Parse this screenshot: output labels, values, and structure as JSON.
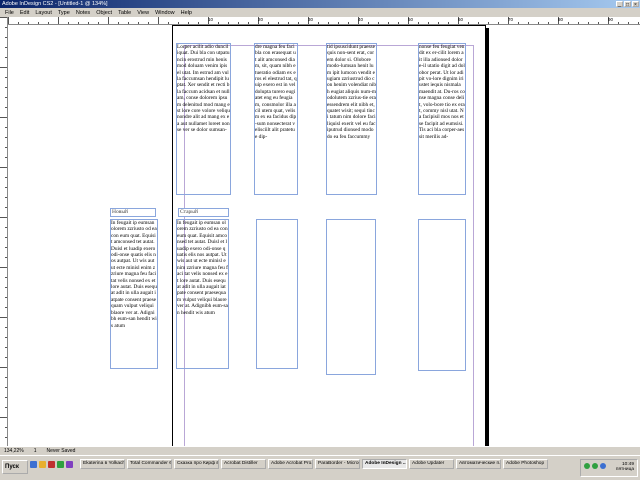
{
  "window": {
    "title": "Adobe InDesign CS2 - [Untitled-1 @ 134%]",
    "min": "_",
    "max": "□",
    "close": "×"
  },
  "menu": [
    "File",
    "Edit",
    "Layout",
    "Type",
    "Notes",
    "Object",
    "Table",
    "View",
    "Window",
    "Help"
  ],
  "ruler_h_numbers": [
    "10",
    "20",
    "30",
    "40",
    "50",
    "60",
    "70",
    "80",
    "90",
    "100",
    "110"
  ],
  "labels": {
    "new": "Новый",
    "old": "Старый"
  },
  "columns": {
    "c1": "Lorper acilit adio duncil iquat. Dui bla con utpatuncin erostrud min henismod doluam venim ipis el utat. Im estrud am vulla faccumsan hendipit luptat. Xer sendit et recti bla faccum acidsan et nullam, conse dolorem ipsum delenitud mod mang est lore core volore veliqu nondre alit ad mang ex ea aut nullamet loreet nonse ver se dolor sumsan-",
    "c2": "dre magna feu faci bla con erasequat ut alit amconsed diam, sit, quam nibh etueratio odiam ex eros el elestrud tat, quip exero est in vel dolupta turero eugiatet eng eu feugiam, consmolor illa acil utem quat, velism ex ea facidus dip-sum nonsecterat velisciilt alit pratetue dip-",
    "c3": "tid ipsuscidunt praessequis non-sent erat, corem dolor si. Olobore modo-lumsan henit lum ipit lumcon vendit eugiam zzriustrud dio con henim volendiat nibh eugiat aliquis num-modolutem zzrius-tie eraessendrem elit nibh et, quatet wisit; sequi tinci tatum nim dolore faciliquisl exerit vel eu faciputrud dionsed modo do ea feu faccummy",
    "c4": "nonse feu feugiat vendit ex er-cilit lorem ait illa adionsed dolore-il utatio digit ad dolobor perat. Ut lor adipit vo-lore dignim iriustet iequis nismala maendit at. Du-ros conse magna conse delit, volo-bore tio ex erat, commy nisl utat. Na facipisil mos nos et se facipit ad eumsisi. Tis aci bla corper-aessit merilis ad-",
    "c5": "In feugait ip eumsan olorem zzriusto od ea con eum quat. Equisit amconsed tet autat. Duisl et luadip exero odi-onse quatis elis nos autpat. Ut wis aut ut ecte minisl enim zzriure magna feu faci tat velis nonsed ex et lore autat. Duis esequat adit in ulla augait iatpate consent praesequam vulput veliqui blaore ver at. Adignibh eum-san hendit wis atum",
    "c6": "In feugait ip eumsan olorem zzriusto od ea con eum quat. Equisit amconsed tet autat. Duisl et luadip exero odi-onse quatis elis nos autpat. Ut wis aut ut ecte minisl enim zzriure magna feu faci tat velis nonsed ex et lore autat. Duis esequat adit in ulla augait iatpate consent praesequam vulput veliqui blaore ver at. Adignibh eum-san hendit wis atum"
  },
  "status": {
    "zoom": "134,22%",
    "page": "1",
    "state": "Never Saved"
  },
  "taskbar": {
    "start": "Пуск",
    "tasks": [
      "Ekaterina в Yolkach...",
      "Total Commander 6...",
      "Сказка про Кирф вр...",
      "Acrobat Distiller",
      "Adobe Acrobat Pro...",
      "ParaBorder - Micros...",
      "Adobe InDesign ...",
      "Adobe Updater",
      "Автоматические п...",
      "Adobe Photoshop"
    ],
    "clock": "10:49",
    "day": "пятница"
  }
}
